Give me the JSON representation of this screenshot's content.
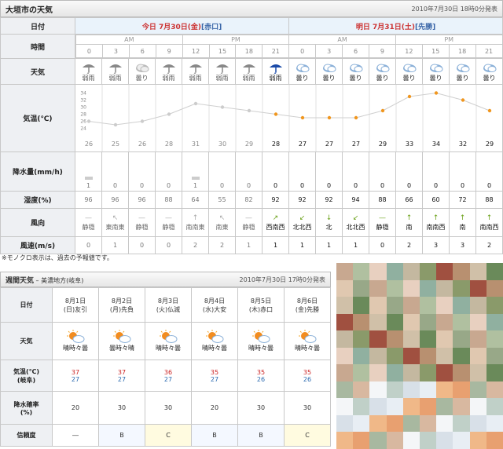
{
  "header": {
    "title": "大垣市の天気",
    "issued": "2010年7月30日 18時0分発表"
  },
  "hourly": {
    "labels": {
      "date": "日付",
      "time": "時間",
      "weather": "天気",
      "temp": "気温(℃)",
      "rain": "降水量(mm/h)",
      "humidity": "湿度(%)",
      "wind_dir": "風向",
      "wind_speed": "風速(m/s)"
    },
    "today": {
      "label": "今日 7月30日(金)",
      "rokuyo": "[赤口]"
    },
    "tomorrow": {
      "label": "明日 7月31日(土)",
      "rokuyo": "[先勝]"
    },
    "am": "AM",
    "pm": "PM",
    "hours": [
      "0",
      "3",
      "6",
      "9",
      "12",
      "15",
      "18",
      "21",
      "0",
      "3",
      "6",
      "9",
      "12",
      "15",
      "18",
      "21"
    ],
    "weather": [
      "弱雨",
      "弱雨",
      "曇り",
      "弱雨",
      "弱雨",
      "弱雨",
      "弱雨",
      "弱雨",
      "曇り",
      "曇り",
      "曇り",
      "曇り",
      "曇り",
      "曇り",
      "曇り",
      "曇り"
    ],
    "temps": [
      "26",
      "25",
      "26",
      "28",
      "31",
      "30",
      "29",
      "28",
      "27",
      "27",
      "27",
      "29",
      "33",
      "34",
      "32",
      "29"
    ],
    "temp_axis": [
      "34",
      "32",
      "30",
      "28",
      "26",
      "24"
    ],
    "rain": [
      "1",
      "0",
      "0",
      "0",
      "1",
      "0",
      "0",
      "0",
      "0",
      "0",
      "0",
      "0",
      "0",
      "0",
      "0",
      "0"
    ],
    "humidity": [
      "96",
      "96",
      "96",
      "88",
      "64",
      "55",
      "82",
      "92",
      "92",
      "92",
      "94",
      "88",
      "66",
      "60",
      "72",
      "88"
    ],
    "wind_dir": [
      "静穏",
      "東南東",
      "静穏",
      "静穏",
      "南南東",
      "南東",
      "静穏",
      "西南西",
      "北北西",
      "北",
      "北北西",
      "静穏",
      "南",
      "南南西",
      "南",
      "南南西"
    ],
    "wind_speed": [
      "0",
      "1",
      "0",
      "0",
      "2",
      "2",
      "1",
      "1",
      "1",
      "1",
      "1",
      "0",
      "2",
      "3",
      "3",
      "2"
    ],
    "current_from": 7
  },
  "note": "※モノクロ表示は、過去の予報値です。",
  "weekly": {
    "title": "週間天気",
    "region": "美濃地方(岐阜)",
    "issued": "2010年7月30日 17時0分発表",
    "labels": {
      "date": "日付",
      "weather": "天気",
      "temp": "気温(℃)",
      "temp_sub": "(岐阜)",
      "rain": "降水確率",
      "rain_sub": "(%)",
      "reliability": "信頼度"
    },
    "days": [
      {
        "date": "8月1日",
        "dow": "(日)友引",
        "weather": "晴時々曇",
        "hi": "37",
        "lo": "27",
        "rain": "20",
        "rel": "―"
      },
      {
        "date": "8月2日",
        "dow": "(月)先負",
        "weather": "曇時々晴",
        "hi": "37",
        "lo": "27",
        "rain": "30",
        "rel": "B"
      },
      {
        "date": "8月3日",
        "dow": "(火)仏滅",
        "weather": "晴時々曇",
        "hi": "36",
        "lo": "27",
        "rain": "30",
        "rel": "C"
      },
      {
        "date": "8月4日",
        "dow": "(水)大安",
        "weather": "晴時々曇",
        "hi": "35",
        "lo": "27",
        "rain": "20",
        "rel": "B"
      },
      {
        "date": "8月5日",
        "dow": "(木)赤口",
        "weather": "晴時々曇",
        "hi": "35",
        "lo": "26",
        "rain": "30",
        "rel": "B"
      },
      {
        "date": "8月6日",
        "dow": "(金)先勝",
        "weather": "晴時々曇",
        "hi": "35",
        "lo": "26",
        "rain": "30",
        "rel": "C"
      }
    ]
  },
  "chart_data": {
    "type": "line",
    "x": [
      "0",
      "3",
      "6",
      "9",
      "12",
      "15",
      "18",
      "21",
      "0",
      "3",
      "6",
      "9",
      "12",
      "15",
      "18",
      "21"
    ],
    "series": [
      {
        "values": [
          26,
          25,
          26,
          28,
          31,
          30,
          29,
          28,
          27,
          27,
          27,
          29,
          33,
          34,
          32,
          29
        ]
      }
    ],
    "ylim": [
      23,
      35
    ],
    "colors": {
      "past": "#cccccc",
      "forecast": "#f0961e"
    }
  }
}
